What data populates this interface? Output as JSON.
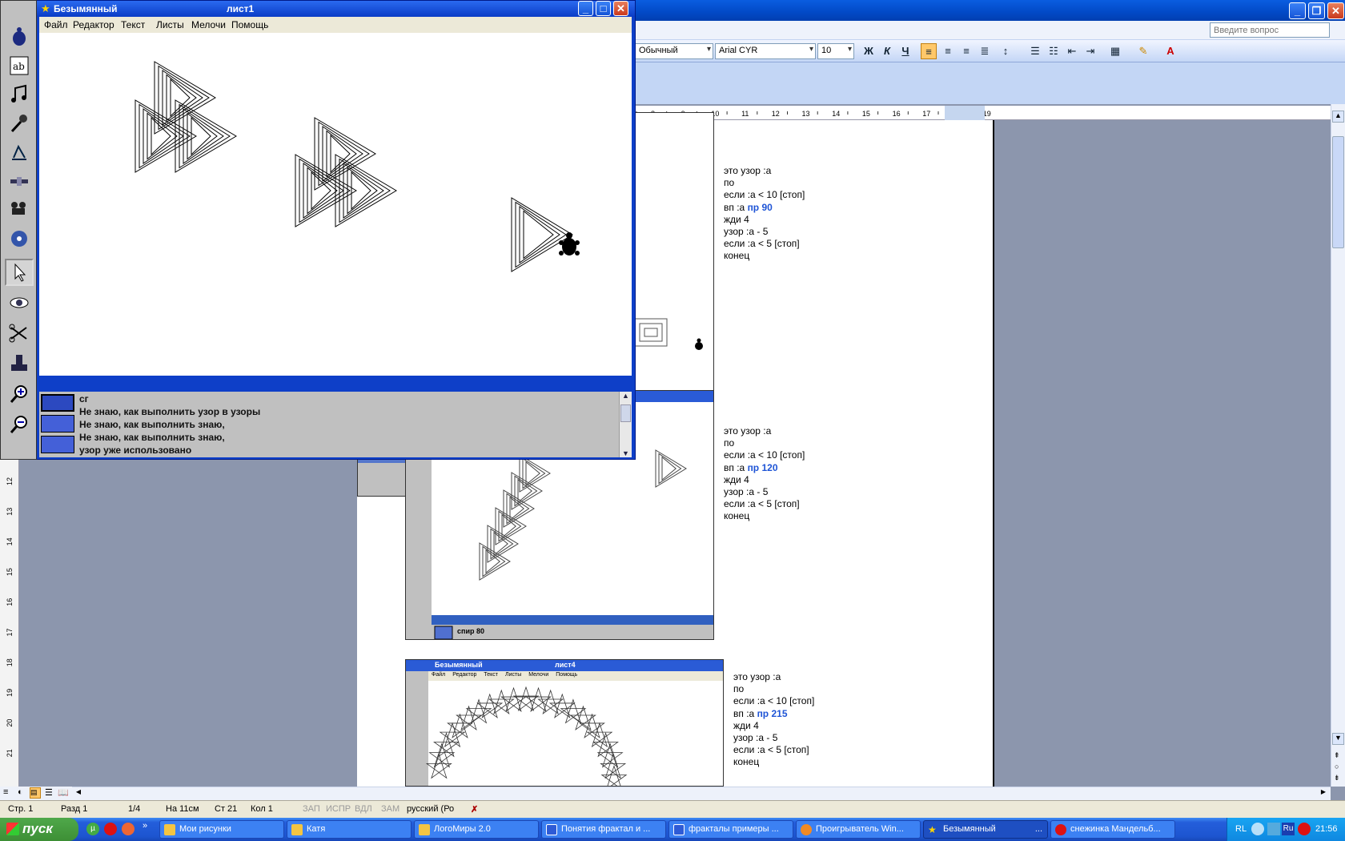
{
  "word": {
    "style_combo": "Обычный",
    "font_combo": "Arial CYR",
    "size_combo": "10",
    "ask_box_placeholder": "Введите вопрос",
    "toolbar": {
      "bold": "Ж",
      "italic": "К",
      "underline": "Ч"
    },
    "ruler_numbers": [
      "8",
      "9",
      "10",
      "11",
      "12",
      "13",
      "14",
      "15",
      "16",
      "17",
      "18",
      "19"
    ],
    "vruler_numbers": [
      "12",
      "13",
      "14",
      "15",
      "16",
      "17",
      "18",
      "19",
      "20",
      "21"
    ],
    "blocks": [
      {
        "l1": "это узор :а",
        "l2": "по",
        "l3": "если :а < 10 [стоп]",
        "l4a": "вп :а",
        "l4b": "пр",
        "l4num": "90",
        "l5": "жди 4",
        "l6": "узор :а - 5",
        "l7": "если :а < 5 [стоп]",
        "l8": "конец"
      },
      {
        "l1": "это узор :а",
        "l2": "по",
        "l3": "если :а < 10 [стоп]",
        "l4a": "вп :а",
        "l4b": "пр",
        "l4num": "120",
        "l5": "жди 4",
        "l6": "узор :а - 5",
        "l7": "если :а < 5 [стоп]",
        "l8": "конец"
      },
      {
        "l1": "это узор :а",
        "l2": "по",
        "l3": "если :а < 10 [стоп]",
        "l4a": "вп :а",
        "l4b": "пр",
        "l4num": "215",
        "l5": "жди 4",
        "l6": "узор :а - 5",
        "l7": "если :а < 5 [стоп]",
        "l8": "конец"
      }
    ],
    "shot2_cmd": "спир 80",
    "shot3": {
      "title": "Безымянный",
      "sheet": "лист4",
      "menu": [
        "Файл",
        "Редактор",
        "Текст",
        "Листы",
        "Мелочи",
        "Помощь"
      ]
    },
    "status": {
      "page": "Стр. 1",
      "section": "Разд 1",
      "pages": "1/4",
      "at": "На 11см",
      "line": "Ст 21",
      "col": "Кол 1",
      "rec": "ЗАП",
      "trk": "ИСПР",
      "ext": "ВДЛ",
      "ovr": "ЗАМ",
      "lang": "русский (Ро"
    }
  },
  "logo": {
    "title": "Безымянный",
    "sheet": "лист1",
    "menu": [
      "Файл",
      "Редактор",
      "Текст",
      "Листы",
      "Мелочи",
      "Помощь"
    ],
    "cmd_lines": [
      "сг",
      "Не знаю, как выполнить узор в  узоры",
      "Не знаю, как выполнить знаю,",
      "Не знаю, как выполнить знаю,",
      "узор уже использовано"
    ]
  },
  "taskbar": {
    "start": "пуск",
    "tasks": [
      "Мои рисунки",
      "Катя",
      "ЛогоМиры 2.0",
      "Понятия фрактал и ...",
      "фракталы примеры ...",
      "Проигрыватель Win...",
      "Безымянный",
      "снежинка Мандельб..."
    ],
    "tasks_more": "...",
    "tray_lang": "RL",
    "tray_kbd": "Ru",
    "clock": "21:56"
  }
}
